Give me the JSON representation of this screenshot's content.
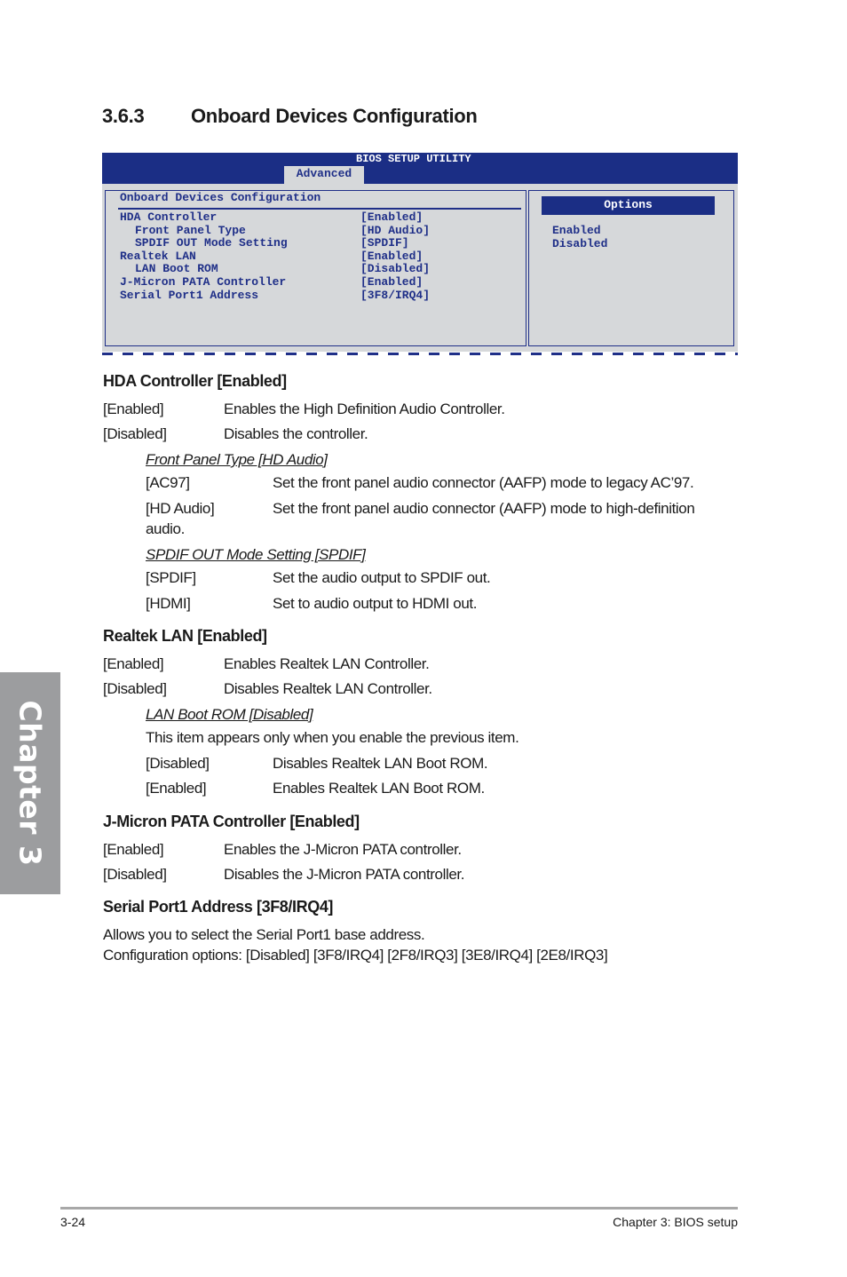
{
  "section": {
    "number": "3.6.3",
    "title": "Onboard Devices Configuration"
  },
  "bios": {
    "title": "BIOS SETUP UTILITY",
    "tab": "Advanced",
    "panel_title": "Onboard Devices Configuration",
    "items": [
      {
        "label": "HDA Controller",
        "value": "[Enabled]",
        "indent": false
      },
      {
        "label": "Front Panel Type",
        "value": "[HD Audio]",
        "indent": true
      },
      {
        "label": "SPDIF OUT Mode Setting",
        "value": "[SPDIF]",
        "indent": true
      },
      {
        "label": "Realtek LAN",
        "value": "[Enabled]",
        "indent": false
      },
      {
        "label": "LAN Boot ROM",
        "value": "[Disabled]",
        "indent": true
      },
      {
        "label": "J-Micron PATA Controller",
        "value": "[Enabled]",
        "indent": false
      },
      {
        "label": "Serial Port1 Address",
        "value": "[3F8/IRQ4]",
        "indent": false
      }
    ],
    "options_title": "Options",
    "options": [
      "Enabled",
      "Disabled"
    ]
  },
  "hda": {
    "heading": "HDA Controller [Enabled]",
    "rows": [
      {
        "key": "[Enabled]",
        "desc": "Enables the High Definition Audio Controller."
      },
      {
        "key": "[Disabled]",
        "desc": "Disables the controller."
      }
    ],
    "front_panel": {
      "heading": "Front Panel Type [HD Audio]",
      "rows": [
        {
          "key": "[AC97]",
          "desc": "Set the front panel audio connector (AAFP) mode to legacy AC’97."
        },
        {
          "key": "[HD Audio]",
          "desc": "Set the front panel audio connector (AAFP) mode to high-definition"
        }
      ],
      "wrap": "audio."
    },
    "spdif": {
      "heading": "SPDIF OUT Mode Setting [SPDIF]",
      "rows": [
        {
          "key": "[SPDIF]",
          "desc": "Set the audio output to SPDIF out."
        },
        {
          "key": "[HDMI]",
          "desc": "Set to audio output to HDMI out."
        }
      ]
    }
  },
  "lan": {
    "heading": "Realtek LAN [Enabled]",
    "rows": [
      {
        "key": "[Enabled]",
        "desc": "Enables Realtek LAN Controller."
      },
      {
        "key": "[Disabled]",
        "desc": "Disables Realtek LAN Controller."
      }
    ],
    "boot_rom": {
      "heading": "LAN Boot ROM [Disabled]",
      "note": "This item appears only when you enable the previous item.",
      "rows": [
        {
          "key": "[Disabled]",
          "desc": "Disables Realtek LAN Boot ROM."
        },
        {
          "key": "[Enabled]",
          "desc": "Enables Realtek LAN Boot ROM."
        }
      ]
    }
  },
  "jmicron": {
    "heading": "J-Micron PATA Controller [Enabled]",
    "rows": [
      {
        "key": "[Enabled]",
        "desc": "Enables the J-Micron PATA controller."
      },
      {
        "key": "[Disabled]",
        "desc": "Disables the J-Micron PATA controller."
      }
    ]
  },
  "serial": {
    "heading": "Serial Port1 Address [3F8/IRQ4]",
    "line1": "Allows you to select the Serial Port1 base address.",
    "line2": "Configuration options: [Disabled] [3F8/IRQ4] [2F8/IRQ3] [3E8/IRQ4] [2E8/IRQ3]"
  },
  "side_tab": "Chapter 3",
  "footer": {
    "page": "3-24",
    "chapter": "Chapter 3: BIOS setup"
  }
}
